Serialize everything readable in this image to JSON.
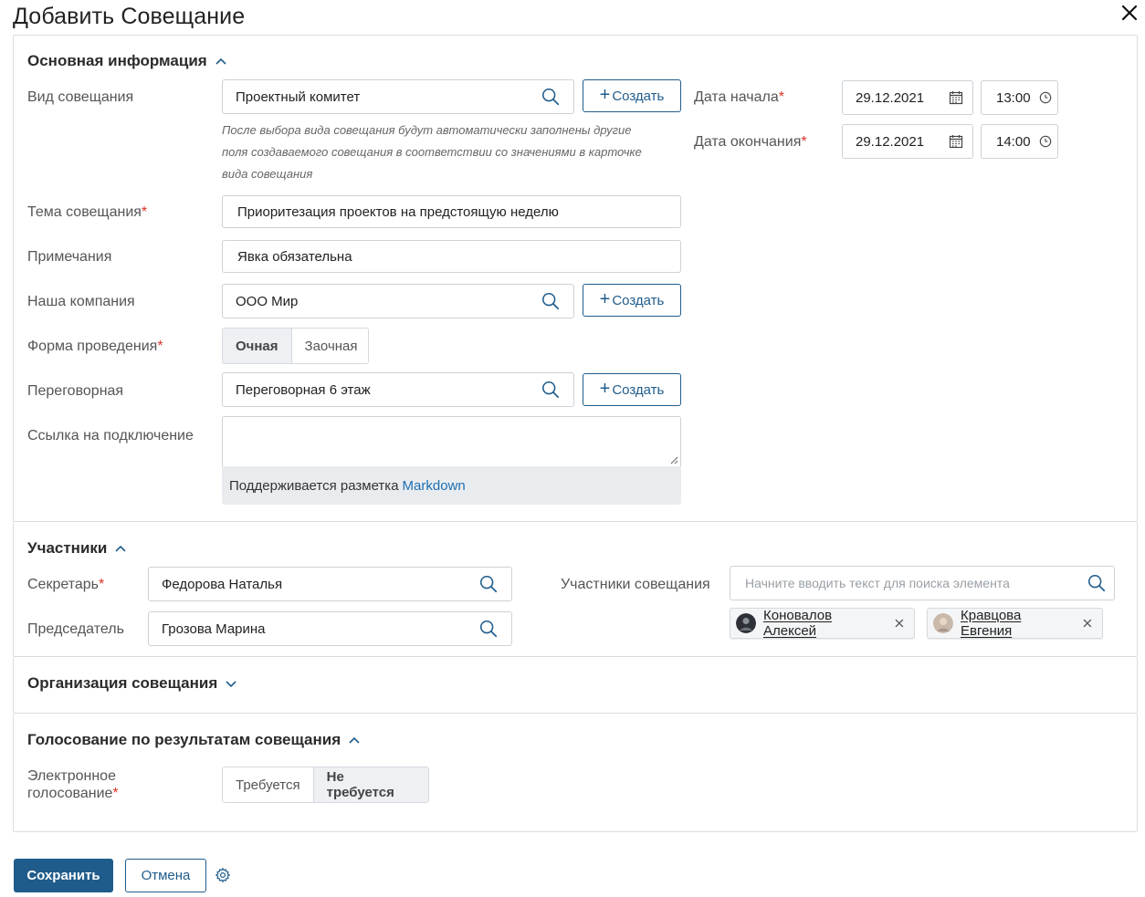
{
  "dialog": {
    "title": "Добавить Совещание"
  },
  "main_info": {
    "title": "Основная информация",
    "meeting_type": {
      "label": "Вид совещания",
      "value": "Проектный комитет",
      "create_label": "Создать"
    },
    "hint": "После выбора вида совещания будут автоматически заполнены другие поля создаваемого совещания в соответствии со значениями в карточке вида совещания",
    "topic": {
      "label": "Тема совещания",
      "value": "Приоритезация проектов на предстоящую неделю"
    },
    "notes": {
      "label": "Примечания",
      "value": "Явка обязательна"
    },
    "company": {
      "label": "Наша компания",
      "value": "ООО Мир",
      "create_label": "Создать"
    },
    "format": {
      "label": "Форма проведения",
      "options": [
        "Очная",
        "Заочная"
      ],
      "selected": "Очная"
    },
    "room": {
      "label": "Переговорная",
      "value": "Переговорная 6 этаж",
      "create_label": "Создать"
    },
    "link": {
      "label": "Ссылка на подключение",
      "value": "",
      "markdown_text": "Поддерживается разметка",
      "markdown_link": "Markdown"
    },
    "start": {
      "label": "Дата начала",
      "date": "29.12.2021",
      "time": "13:00"
    },
    "end": {
      "label": "Дата окончания",
      "date": "29.12.2021",
      "time": "14:00"
    }
  },
  "participants": {
    "title": "Участники",
    "secretary": {
      "label": "Секретарь",
      "value": "Федорова Наталья"
    },
    "chairman": {
      "label": "Председатель",
      "value": "Грозова Марина"
    },
    "members": {
      "label": "Участники совещания",
      "placeholder": "Начните вводить текст для поиска элемента",
      "chips": [
        "Коновалов Алексей",
        "Кравцова Евгения"
      ]
    }
  },
  "organization": {
    "title": "Организация совещания"
  },
  "voting": {
    "title": "Голосование по результатам совещания",
    "electronic": {
      "label_line1": "Электронное",
      "label_line2": "голосование",
      "options": [
        "Требуется",
        "Не требуется"
      ],
      "selected": "Не требуется"
    }
  },
  "footer": {
    "save_label": "Сохранить",
    "cancel_label": "Отмена"
  },
  "colors": {
    "accent": "#1f5c8c",
    "required": "#d9322a",
    "link": "#1f6fb2"
  },
  "icons": [
    "close-icon",
    "search-icon",
    "calendar-icon",
    "clock-icon",
    "chevron-up-icon",
    "chevron-down-icon",
    "remove-icon",
    "gear-icon"
  ]
}
